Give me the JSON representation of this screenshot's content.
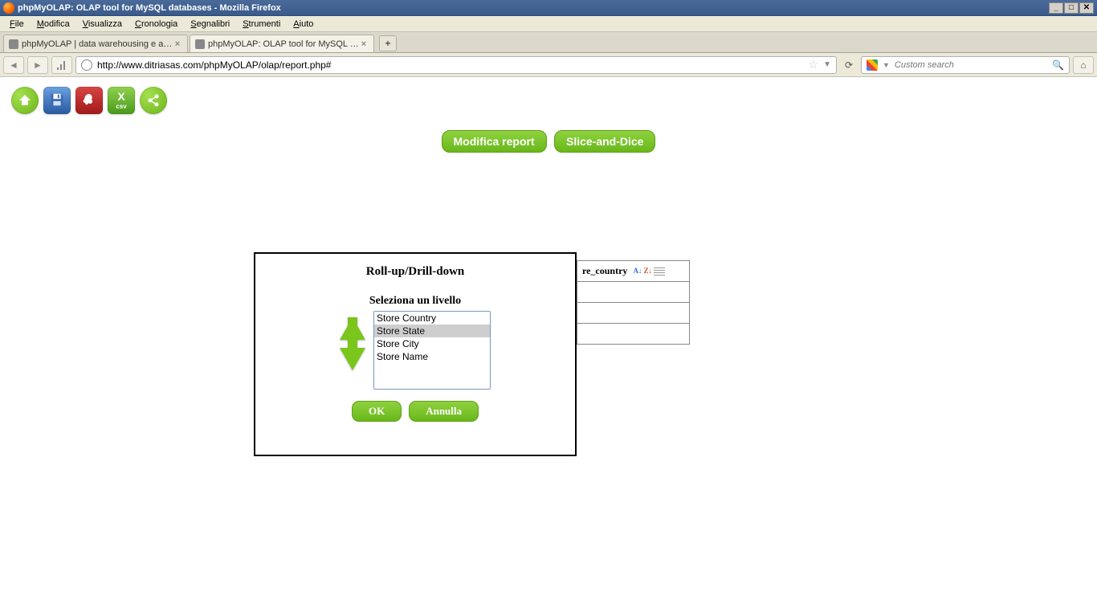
{
  "window": {
    "title": "phpMyOLAP: OLAP tool for MySQL databases - Mozilla Firefox"
  },
  "menu": {
    "items": [
      "File",
      "Modifica",
      "Visualizza",
      "Cronologia",
      "Segnalibri",
      "Strumenti",
      "Aiuto"
    ]
  },
  "tabs": {
    "list": [
      {
        "label": "phpMyOLAP | data warehousing e analisi ...",
        "active": false
      },
      {
        "label": "phpMyOLAP: OLAP tool for MySQL datab...",
        "active": true
      }
    ]
  },
  "address": {
    "url": "http://www.ditriasas.com/phpMyOLAP/olap/report.php#"
  },
  "search": {
    "placeholder": "Custom search"
  },
  "actions": {
    "modify_report": "Modifica report",
    "slice_and_dice": "Slice-and-Dice"
  },
  "bg_column": {
    "header": "re_country"
  },
  "dialog": {
    "title": "Roll-up/Drill-down",
    "subtitle": "Seleziona un livello",
    "levels": [
      "Store Country",
      "Store State",
      "Store City",
      "Store Name"
    ],
    "selected": "Store State",
    "ok": "OK",
    "cancel": "Annulla"
  }
}
